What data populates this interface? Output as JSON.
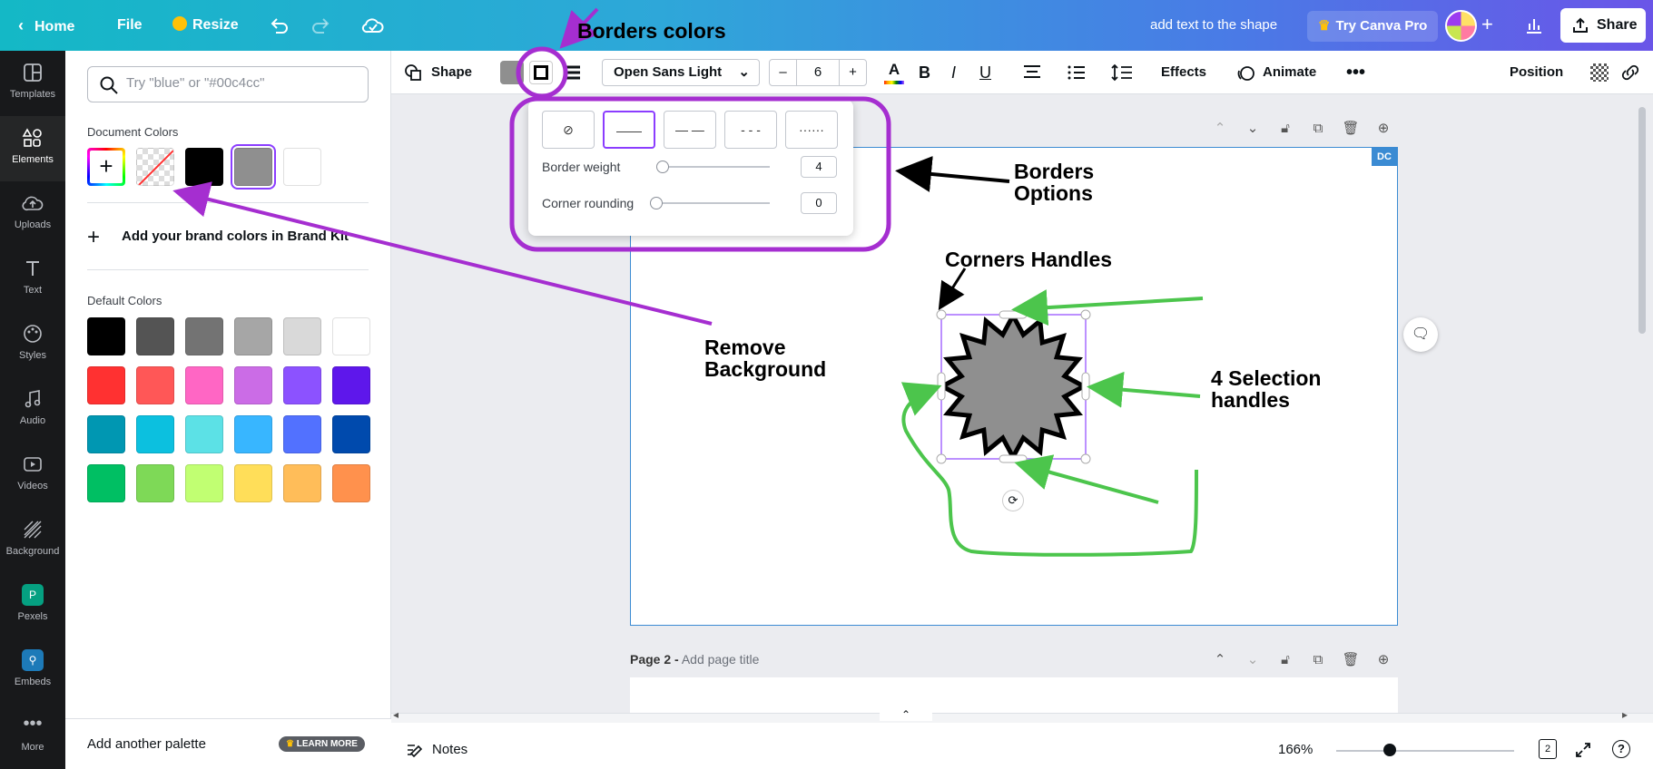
{
  "topbar": {
    "home": "Home",
    "file": "File",
    "resize": "Resize",
    "doc_title": "add text to the shape",
    "try_pro": "Try Canva Pro",
    "share": "Share"
  },
  "rail": [
    {
      "label": "Templates"
    },
    {
      "label": "Elements"
    },
    {
      "label": "Uploads"
    },
    {
      "label": "Text"
    },
    {
      "label": "Styles"
    },
    {
      "label": "Audio"
    },
    {
      "label": "Videos"
    },
    {
      "label": "Background"
    },
    {
      "label": "Pexels"
    },
    {
      "label": "Embeds"
    },
    {
      "label": "More"
    }
  ],
  "panel": {
    "search_placeholder": "Try \"blue\" or \"#00c4cc\"",
    "document_colors_title": "Document Colors",
    "document_colors": [
      "#000000",
      "#8f8f8f",
      "#ffffff"
    ],
    "brand_kit": "Add your brand colors in Brand Kit",
    "default_colors_title": "Default Colors",
    "default_colors": [
      "#000000",
      "#545454",
      "#737373",
      "#a6a6a6",
      "#d9d9d9",
      "#ffffff",
      "#ff3131",
      "#ff5757",
      "#ff66c4",
      "#cb6ce6",
      "#8c52ff",
      "#5e17eb",
      "#0097b2",
      "#0cc0df",
      "#5ce1e6",
      "#38b6ff",
      "#5271ff",
      "#004aad",
      "#00bf63",
      "#7ed957",
      "#c1ff72",
      "#ffde59",
      "#ffbd59",
      "#ff914d"
    ],
    "add_palette": "Add another palette",
    "learn_more": "LEARN MORE"
  },
  "toolbar": {
    "shape": "Shape",
    "font": "Open Sans Light",
    "font_size": "6",
    "effects": "Effects",
    "animate": "Animate",
    "position": "Position"
  },
  "border_popup": {
    "styles": [
      "⊘",
      "——",
      "— —",
      "- - -",
      "······"
    ],
    "weight_label": "Border weight",
    "weight_value": "4",
    "rounding_label": "Corner rounding",
    "rounding_value": "0"
  },
  "canvas": {
    "dc_badge": "DC",
    "page2_prefix": "Page 2 -",
    "page2_title": "Add page title"
  },
  "annotations": {
    "borders_colors": "Borders colors",
    "borders_options_1": "Borders",
    "borders_options_2": "Options",
    "corners_handles": "Corners Handles",
    "remove_bg_1": "Remove",
    "remove_bg_2": "Background",
    "selection_1": "4 Selection",
    "selection_2": "handles"
  },
  "bottom": {
    "notes": "Notes",
    "zoom": "166%",
    "pages": "2"
  }
}
